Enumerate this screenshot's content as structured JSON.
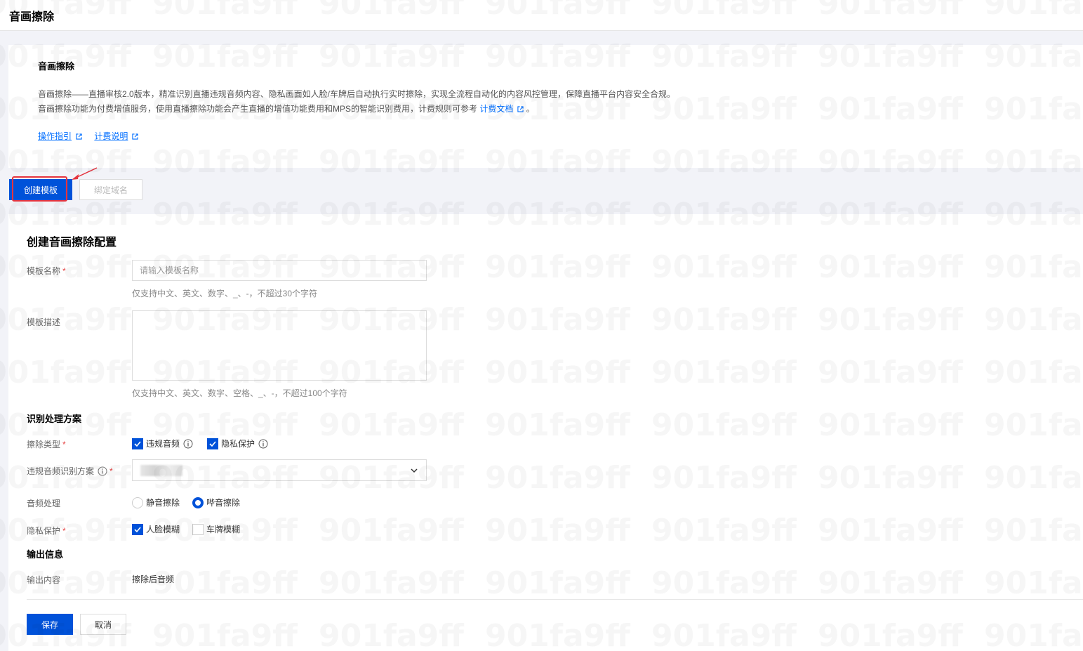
{
  "header": {
    "title": "音画擦除"
  },
  "intro": {
    "title": "音画擦除",
    "desc_line1": "音画擦除——直播审核2.0版本，精准识别直播违规音频内容、隐私画面如人脸/车牌后自动执行实时擦除，实现全流程自动化的内容风控管理，保障直播平台内容安全合规。",
    "desc_line2_prefix": "音画擦除功能为付费增值服务，使用直播擦除功能会产生直播的增值功能费用和MPS的智能识别费用，计费规则可参考",
    "desc_line2_link": "计费文档",
    "desc_line2_suffix": "。",
    "link_guide": "操作指引",
    "link_billing": "计费说明"
  },
  "toolbar": {
    "create_label": "创建模板",
    "bind_label": "绑定域名"
  },
  "form": {
    "title": "创建音画擦除配置",
    "name_label": "模板名称",
    "name_placeholder": "请输入模板名称",
    "name_value": "",
    "name_hint": "仅支持中文、英文、数字、_、-，不超过30个字符",
    "desc_label": "模板描述",
    "desc_value": "",
    "desc_hint": "仅支持中文、英文、数字、空格、_、-，不超过100个字符",
    "section_recognition": "识别处理方案",
    "erase_type_label": "擦除类型",
    "erase_type_options": [
      {
        "label": "违规音频",
        "checked": true
      },
      {
        "label": "隐私保护",
        "checked": true
      }
    ],
    "audio_scheme_label": "违规音频识别方案",
    "audio_scheme_value": "",
    "audio_processing_label": "音频处理",
    "audio_processing_options": [
      {
        "label": "静音擦除",
        "selected": false
      },
      {
        "label": "哔音擦除",
        "selected": true
      }
    ],
    "privacy_label": "隐私保护",
    "privacy_options": [
      {
        "label": "人脸模糊",
        "checked": true
      },
      {
        "label": "车牌模糊",
        "checked": false
      }
    ],
    "section_output": "输出信息",
    "output_label": "输出内容",
    "output_value": "擦除后音频",
    "required_mark": "*",
    "save_label": "保存",
    "cancel_label": "取消"
  },
  "watermark_text": "901fa9ff",
  "colors": {
    "primary": "#0052d9",
    "link": "#006eff",
    "required": "#e54545",
    "highlight": "#e5343e",
    "background": "#f2f3f8"
  },
  "icons": [
    "external-link-icon",
    "info-icon",
    "chevron-down-icon",
    "check-icon",
    "arrow-annotation-icon"
  ]
}
